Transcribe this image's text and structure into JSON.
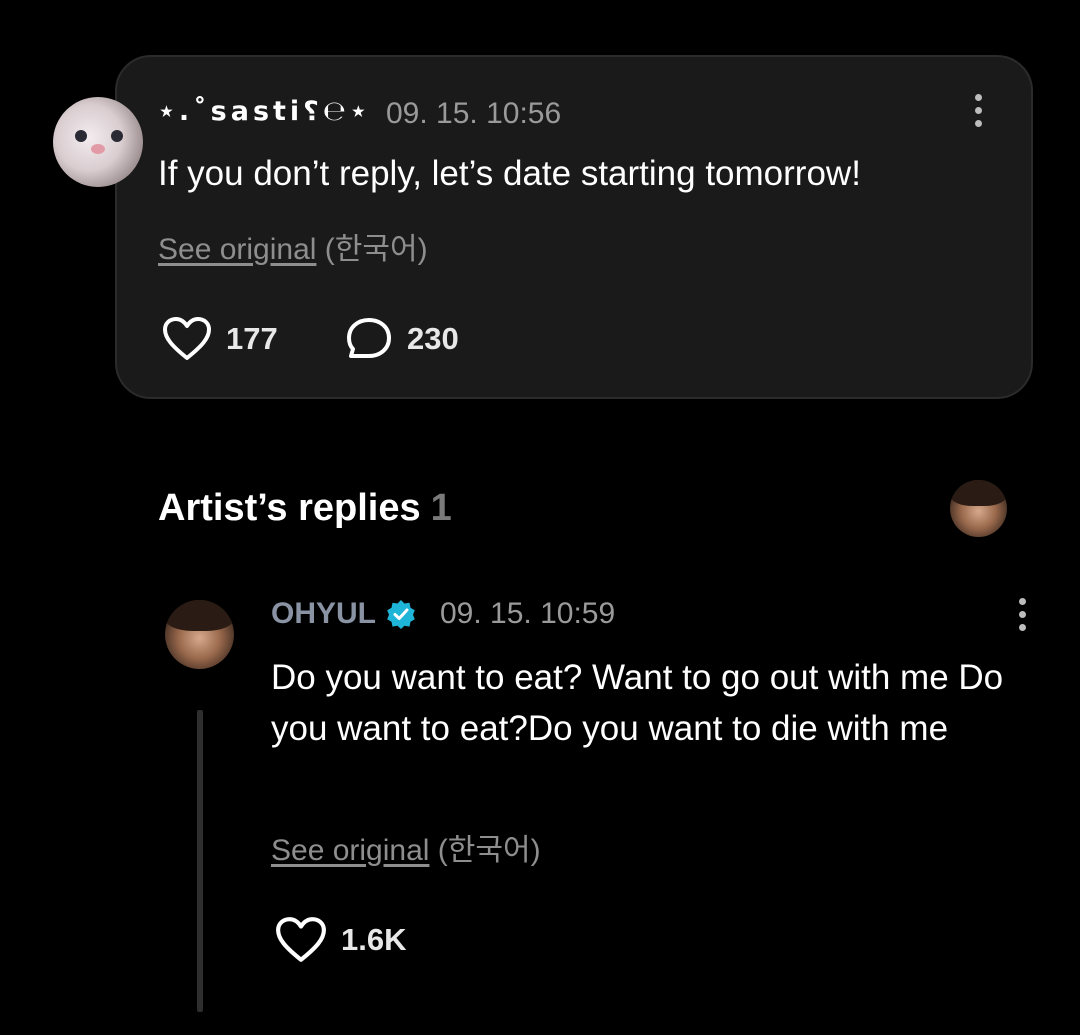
{
  "post": {
    "username": "⋆.˚sasti⸮℮⋆",
    "timestamp": "09. 15. 10:56",
    "text": "If you don’t reply, let’s date starting tomorrow!",
    "see_original_link": "See original",
    "see_original_lang": "(한국어)",
    "likes": "177",
    "comments": "230"
  },
  "artist_replies": {
    "title": "Artist’s replies",
    "count": "1"
  },
  "reply": {
    "name": "OHYUL",
    "timestamp": "09. 15. 10:59",
    "text": "Do you want to eat? Want to go out with me Do you want to eat?Do you want to die with me",
    "see_original_link": "See original",
    "see_original_lang": "(한국어)",
    "likes": "1.6K"
  },
  "colors": {
    "background": "#000000",
    "card": "#1a1a1a",
    "verified": "#1fb5d8",
    "muted": "#9a9a9a"
  },
  "icons": [
    "more-vertical-icon",
    "heart-icon",
    "comment-bubble-icon",
    "verified-badge-icon"
  ]
}
